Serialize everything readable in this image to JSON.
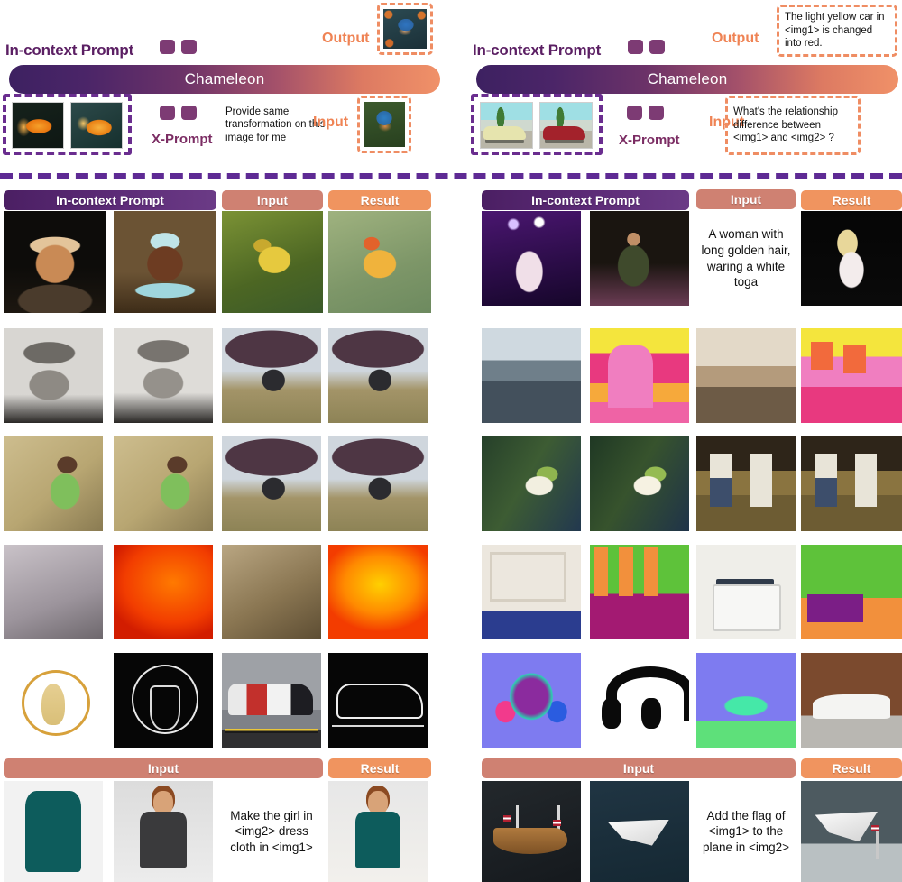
{
  "figure": {
    "model_name": "Chameleon",
    "teaser": {
      "left": {
        "in_context_prompt_label": "In-context Prompt",
        "x_prompt_label": "X-Prompt",
        "input_label": "Input",
        "output_label": "Output",
        "instruction_text": "Provide same transformation on this image for me"
      },
      "right": {
        "in_context_prompt_label": "In-context Prompt",
        "x_prompt_label": "X-Prompt",
        "input_label": "Input",
        "output_label": "Output",
        "input_question": "What's the relationship difference between <img1> and <img2> ?",
        "output_answer": "The light yellow car in <img1> is changed into red."
      }
    },
    "headers": {
      "in_context_prompt": "In-context Prompt",
      "input": "Input",
      "result": "Result"
    },
    "left_panel": {
      "text_rows": [
        {
          "caption": "Make the girl in <img2> dress cloth in <img1>"
        }
      ]
    },
    "right_panel": {
      "row1_prompt": "A woman with long golden hair, waring a white toga",
      "bottom_caption": "Add the flag of <img1> to the plane in <img2>"
    },
    "colors": {
      "purple_dark": "#4b1f63",
      "purple_label": "#5b1f63",
      "purple_token": "#7d3b74",
      "purple_dash": "#6a2d8f",
      "divider_purple": "#5e2a94",
      "orange_accent": "#ef8354",
      "orange_dash": "#ef8d63",
      "input_header": "#cf8172",
      "result_header": "#f0945f",
      "banner_gradient_start": "#3d2161",
      "banner_gradient_end": "#f09168"
    }
  }
}
